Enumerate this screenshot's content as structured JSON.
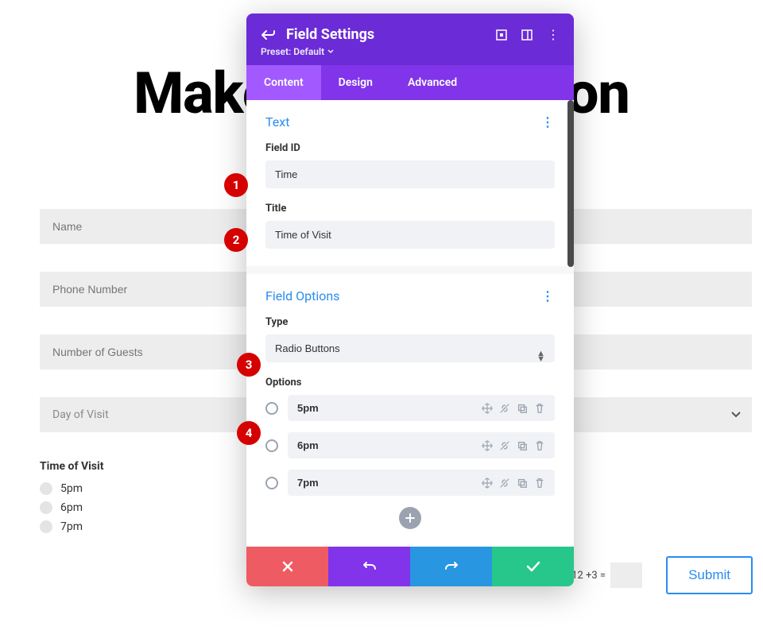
{
  "page": {
    "title": "Make a Reservation",
    "fields": {
      "name": "Name",
      "phone": "Phone Number",
      "guests": "Number of Guests",
      "day": "Day of Visit"
    },
    "time_group_title": "Time of Visit",
    "time_options": {
      "a": "5pm",
      "b": "6pm",
      "c": "7pm"
    },
    "captcha_text": "12 +3 =",
    "submit_label": "Submit"
  },
  "panel": {
    "header_title": "Field Settings",
    "preset_label": "Preset: Default",
    "tabs": {
      "content": "Content",
      "design": "Design",
      "advanced": "Advanced"
    },
    "sections": {
      "text": {
        "title": "Text",
        "field_id_label": "Field ID",
        "field_id_value": "Time",
        "title_label": "Title",
        "title_value": "Time of Visit"
      },
      "field_options": {
        "title": "Field Options",
        "type_label": "Type",
        "type_value": "Radio Buttons",
        "options_label": "Options",
        "options": {
          "a": "5pm",
          "b": "6pm",
          "c": "7pm"
        }
      }
    }
  },
  "callouts": {
    "c1": "1",
    "c2": "2",
    "c3": "3",
    "c4": "4"
  }
}
